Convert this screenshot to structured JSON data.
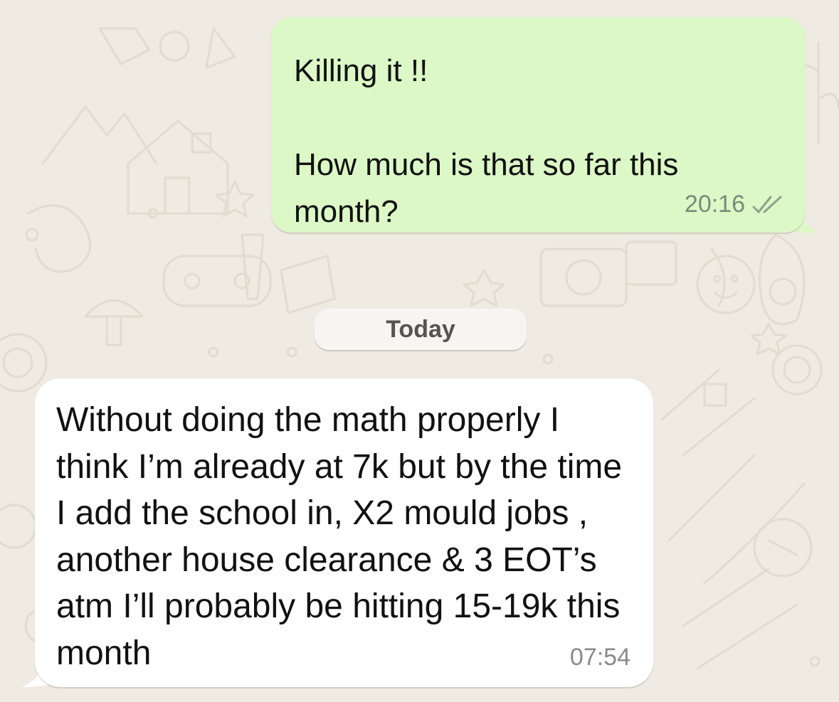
{
  "chat": {
    "outgoing": {
      "text": "Killing it !!\n\nHow much is that so far this month?",
      "time": "20:16",
      "status_icon": "double-check-icon"
    },
    "date_separator": "Today",
    "incoming": {
      "text": "Without doing the math properly I think I’m already at 7k but by the time I add the school in, X2 mould jobs , another house clearance & 3 EOT’s atm I’ll probably be hitting 15-19k this month",
      "time": "07:54"
    }
  },
  "colors": {
    "wallpaper": "#efeae2",
    "outgoing_bubble": "#dcf8c6",
    "incoming_bubble": "#ffffff",
    "date_chip": "#f7f5f2",
    "doodle_stroke": "#e3ddd3"
  }
}
